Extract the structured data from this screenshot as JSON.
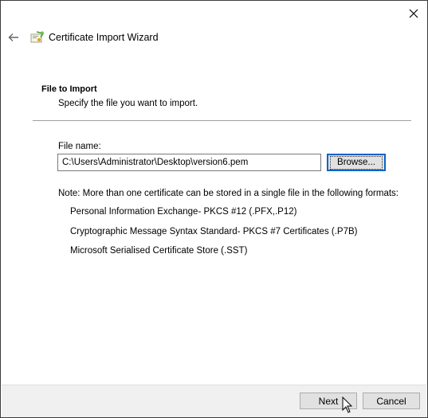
{
  "window": {
    "title": "Certificate Import Wizard",
    "icons": {
      "close": "close-icon",
      "back": "back-arrow-icon",
      "wizard": "certificate-wizard-icon"
    }
  },
  "page": {
    "heading": "File to Import",
    "subheading": "Specify the file you want to import."
  },
  "file": {
    "label": "File name:",
    "value": "C:\\Users\\Administrator\\Desktop\\version6.pem",
    "browse_label": "Browse..."
  },
  "note": {
    "text": "Note:  More than one certificate can be stored in a single file in the following formats:",
    "formats": [
      "Personal Information Exchange- PKCS #12 (.PFX,.P12)",
      "Cryptographic Message Syntax Standard- PKCS #7 Certificates (.P7B)",
      "Microsoft Serialised Certificate Store (.SST)"
    ]
  },
  "footer": {
    "next_label": "Next",
    "cancel_label": "Cancel"
  },
  "colors": {
    "focus_border": "#0a64c8",
    "button_face": "#e1e1e1",
    "footer_bg": "#f0f0f0"
  }
}
